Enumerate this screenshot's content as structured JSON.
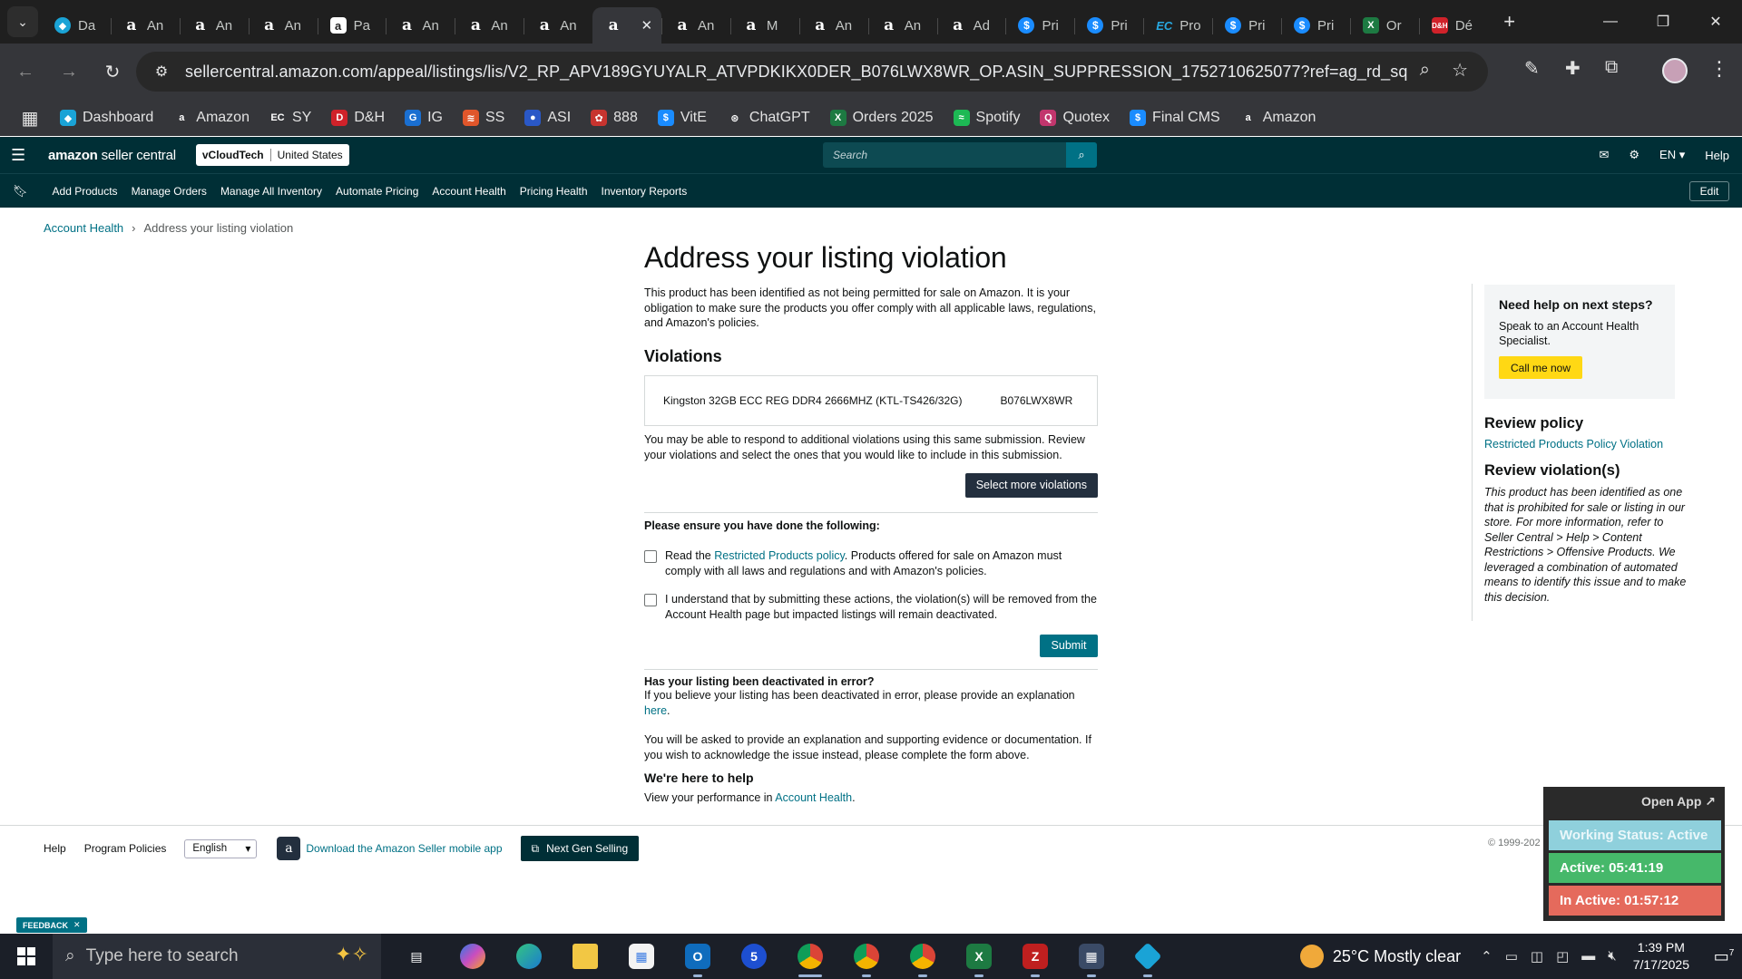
{
  "browser": {
    "tabs": [
      {
        "label": "Da",
        "icon": "seller-icon",
        "kind": "sk"
      },
      {
        "label": "An",
        "icon": "amazon-icon",
        "kind": "amz"
      },
      {
        "label": "An",
        "icon": "amazon-icon",
        "kind": "amz"
      },
      {
        "label": "An",
        "icon": "amazon-icon",
        "kind": "amz"
      },
      {
        "label": "Pa",
        "icon": "password-icon",
        "kind": "pw"
      },
      {
        "label": "An",
        "icon": "amazon-icon",
        "kind": "amz"
      },
      {
        "label": "An",
        "icon": "amazon-icon",
        "kind": "amz"
      },
      {
        "label": "An",
        "icon": "amazon-icon",
        "kind": "amz"
      },
      {
        "label": "",
        "icon": "amazon-icon",
        "kind": "amz",
        "active": true
      },
      {
        "label": "An",
        "icon": "amazon-icon",
        "kind": "amz"
      },
      {
        "label": "M",
        "icon": "amazon-icon",
        "kind": "amz"
      },
      {
        "label": "An",
        "icon": "amazon-icon",
        "kind": "amz"
      },
      {
        "label": "An",
        "icon": "amazon-icon",
        "kind": "amz"
      },
      {
        "label": "Ad",
        "icon": "amazon-icon",
        "kind": "amz"
      },
      {
        "label": "Pri",
        "icon": "dollar-icon",
        "kind": "dollar"
      },
      {
        "label": "Pri",
        "icon": "dollar-icon",
        "kind": "dollar"
      },
      {
        "label": "Pro",
        "icon": "ec-icon",
        "kind": "ec"
      },
      {
        "label": "Pri",
        "icon": "dollar-icon",
        "kind": "dollar"
      },
      {
        "label": "Pri",
        "icon": "dollar-icon",
        "kind": "dollar"
      },
      {
        "label": "Or",
        "icon": "excel-icon",
        "kind": "xl"
      },
      {
        "label": "Dé",
        "icon": "dh-icon",
        "kind": "dh"
      }
    ],
    "url": "sellercentral.amazon.com/appeal/listings/lis/V2_RP_APV189GYUYALR_ATVPDKIKX0DER_B076LWX8WR_OP.ASIN_SUPPRESSION_1752710625077?ref=ag_rd_sq",
    "bookmarks": [
      {
        "label": "Dashboard",
        "icon": "seller-icon",
        "color": "#1aa3d6"
      },
      {
        "label": "Amazon",
        "icon": "amazon-icon",
        "color": "#35363a"
      },
      {
        "label": "SY",
        "icon": "ec-icon",
        "color": "#35363a"
      },
      {
        "label": "D&H",
        "icon": "dh-icon",
        "color": "#d0222a"
      },
      {
        "label": "IG",
        "icon": "ig-icon",
        "color": "#1a6fd1"
      },
      {
        "label": "SS",
        "icon": "ss-icon",
        "color": "#e0562b"
      },
      {
        "label": "ASI",
        "icon": "asi-icon",
        "color": "#2a58c7"
      },
      {
        "label": "888",
        "icon": "888-icon",
        "color": "#c7342f"
      },
      {
        "label": "VitE",
        "icon": "dollar-icon",
        "color": "#1a8cff"
      },
      {
        "label": "ChatGPT",
        "icon": "chatgpt-icon",
        "color": "#35363a"
      },
      {
        "label": "Orders 2025",
        "icon": "excel-icon",
        "color": "#1d7a42"
      },
      {
        "label": "Spotify",
        "icon": "spotify-icon",
        "color": "#1db954"
      },
      {
        "label": "Quotex",
        "icon": "quotex-icon",
        "color": "#c2366d"
      },
      {
        "label": "Final CMS",
        "icon": "dollar-icon",
        "color": "#1a8cff"
      },
      {
        "label": "Amazon",
        "icon": "amazon-icon",
        "color": "#35363a"
      }
    ]
  },
  "sc": {
    "logo_bold": "amazon",
    "logo_light": " seller central",
    "store": "vCloudTech",
    "marketplace": "United States",
    "search_placeholder": "Search",
    "lang": "EN",
    "help": "Help",
    "nav": [
      "Add Products",
      "Manage Orders",
      "Manage All Inventory",
      "Automate Pricing",
      "Account Health",
      "Pricing Health",
      "Inventory Reports"
    ],
    "edit": "Edit"
  },
  "breadcrumb": {
    "parent": "Account Health",
    "current": "Address your listing violation"
  },
  "main": {
    "title": "Address your listing violation",
    "intro": "This product has been identified as not being permitted for sale on Amazon. It is your obligation to make sure the products you offer comply with all applicable laws, regulations, and Amazon's policies.",
    "violations_title": "Violations",
    "product": "Kingston 32GB ECC REG DDR4 2666MHZ (KTL-TS426/32G)",
    "asin": "B076LWX8WR",
    "more_note": "You may be able to respond to additional violations using this same submission. Review your violations and select the ones that you would like to include in this submission.",
    "select_more": "Select more violations",
    "ensure": "Please ensure you have done the following:",
    "check1_pre": "Read the ",
    "check1_link": "Restricted Products policy",
    "check1_post": ". Products offered for sale on Amazon must comply with all laws and regulations and with Amazon's policies.",
    "check2": "I understand that by submitting these actions, the violation(s) will be removed from the Account Health page but impacted listings will remain deactivated.",
    "submit": "Submit",
    "error_q": "Has your listing been deactivated in error?",
    "error_pre": "If you believe your listing has been deactivated in error, please provide an explanation ",
    "error_link": "here",
    "error_post": ".",
    "explain": "You will be asked to provide an explanation and supporting evidence or documentation. If you wish to acknowledge the issue instead, please complete the form above.",
    "help_title": "We're here to help",
    "perf_pre": "View your performance in ",
    "perf_link": "Account Health",
    "perf_post": "."
  },
  "side": {
    "help_title": "Need help on next steps?",
    "help_desc": "Speak to an Account Health Specialist.",
    "call": "Call me now",
    "policy_title": "Review policy",
    "policy_link": "Restricted Products Policy Violation",
    "violation_title": "Review violation(s)",
    "violation_text": "This product has been identified as one that is prohibited for sale or listing in our store. For more information, refer to Seller Central > Help > Content Restrictions > Offensive Products. We leveraged a combination of automated means to identify this issue and to make this decision."
  },
  "footer": {
    "help": "Help",
    "policies": "Program Policies",
    "language": "English",
    "app": "Download the Amazon Seller mobile app",
    "nextgen": "Next Gen Selling",
    "copyright": "© 1999-202"
  },
  "feedback": "FEEDBACK",
  "widget": {
    "open": "Open App ↗",
    "status": "Working Status: Active",
    "active": "Active: 05:41:19",
    "inactive": "In Active: 01:57:12"
  },
  "taskbar": {
    "search_placeholder": "Type here to search",
    "weather": "25°C  Mostly clear",
    "time": "1:39 PM",
    "date": "7/17/2025",
    "notif_count": "7"
  }
}
